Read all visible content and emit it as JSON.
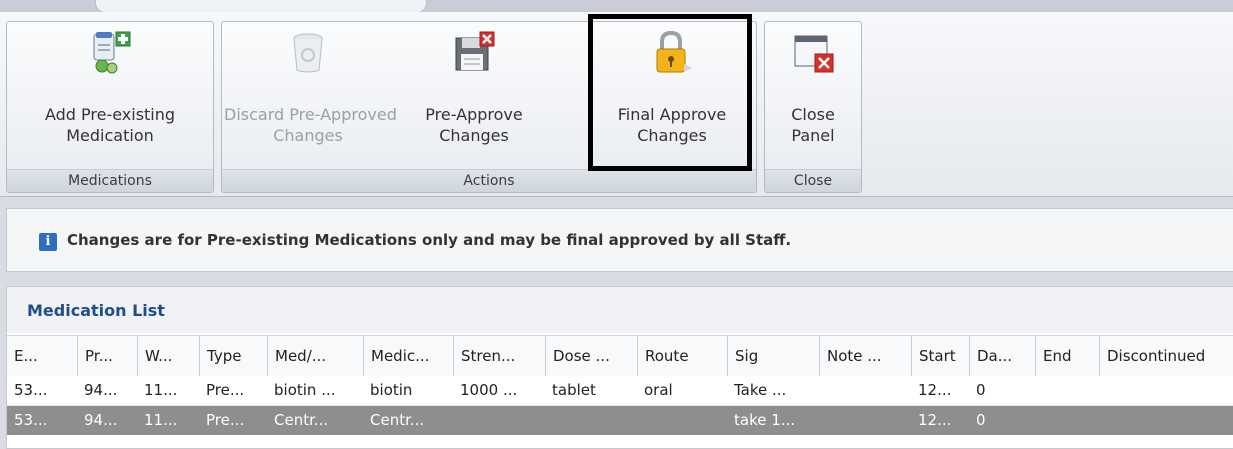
{
  "ribbon": {
    "groups": {
      "medications": "Medications",
      "actions": "Actions",
      "close": "Close"
    },
    "buttons": {
      "add_pre_existing": [
        "Add Pre-existing",
        "Medication"
      ],
      "discard_pre_approved": [
        "Discard Pre-Approved",
        "Changes"
      ],
      "pre_approve": [
        "Pre-Approve",
        "Changes"
      ],
      "final_approve": [
        "Final Approve",
        "Changes"
      ],
      "close_panel": [
        "Close",
        "Panel"
      ]
    }
  },
  "info": {
    "message": "Changes are for Pre-existing Medications only and may be final approved by all Staff."
  },
  "medication_list": {
    "title": "Medication List",
    "columns": [
      "E...",
      "Pr...",
      "W...",
      "Type",
      "Med/...",
      "Medic...",
      "Stren...",
      "Dose ...",
      "Route",
      "Sig",
      "Note ...",
      "Start",
      "Da...",
      "End",
      "Discontinued"
    ],
    "rows": [
      [
        "53...",
        "94...",
        "11...",
        "Pre...",
        "biotin ...",
        "biotin",
        "1000 ...",
        "tablet",
        "oral",
        "Take ...",
        "",
        "12...",
        "0",
        "",
        ""
      ],
      [
        "53...",
        "94...",
        "11...",
        "Pre...",
        "Centr...",
        "Centr...",
        "",
        "",
        "",
        "take 1...",
        "",
        "12...",
        "0",
        "",
        ""
      ]
    ]
  }
}
